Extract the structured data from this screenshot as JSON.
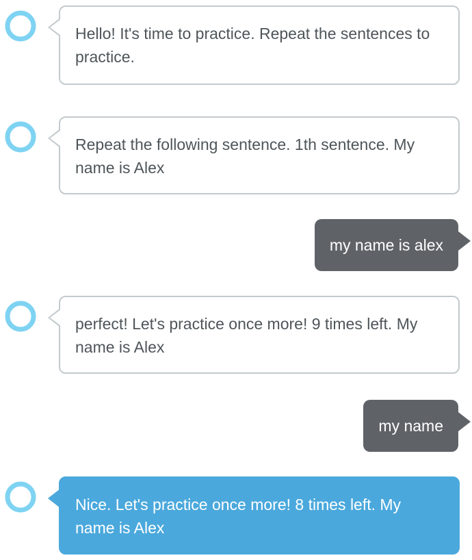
{
  "colors": {
    "alexa_ring": "#7fd3f2",
    "alexa_bubble_border": "#c3cacd",
    "alexa_text": "#4e5559",
    "highlight_bubble": "#4aa8dc",
    "user_bubble": "#5f6368",
    "user_text": "#ffffff"
  },
  "icons": {
    "assistant_avatar": "alexa-ring-icon"
  },
  "messages": [
    {
      "sender": "alexa",
      "text": "Hello! It's time to practice. Repeat the sentences to practice."
    },
    {
      "sender": "alexa",
      "text": "Repeat the following sentence. 1th sentence. My name is Alex"
    },
    {
      "sender": "user",
      "text": "my name is alex"
    },
    {
      "sender": "alexa",
      "text": "perfect! Let's practice once more! 9 times left. My name is Alex"
    },
    {
      "sender": "user",
      "text": "my name"
    },
    {
      "sender": "alexa",
      "text": "Nice. Let's practice once more! 8 times left. My name is Alex",
      "highlighted": true
    }
  ]
}
